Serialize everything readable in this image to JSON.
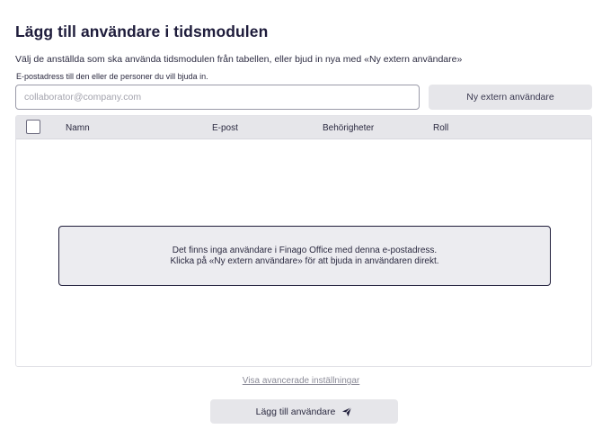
{
  "dialog": {
    "title": "Lägg till användare i tidsmodulen",
    "subtitle": "Välj de anställda som ska använda tidsmodulen från tabellen, eller bjud in nya med «Ny extern användare»",
    "email_label": "E-postadress till den eller de personer du vill bjuda in.",
    "email_value": "",
    "email_placeholder": "collaborator@company.com",
    "new_external_button": "Ny extern användare"
  },
  "table": {
    "columns": [
      "Namn",
      "E-post",
      "Behörigheter",
      "Roll"
    ],
    "rows": [],
    "empty_line1": "Det finns inga användare i Finago Office med denna e-postadress.",
    "empty_line2": "Klicka på «Ny extern användare» för att bjuda in användaren direkt."
  },
  "footer": {
    "advanced_link": "Visa avancerade inställningar",
    "add_button": "Lägg till användare",
    "add_button_icon": "send-icon"
  },
  "colors": {
    "text_dark": "#1e1c3b",
    "button_bg": "#e6e6ea",
    "empty_border": "#1f1d3a"
  }
}
